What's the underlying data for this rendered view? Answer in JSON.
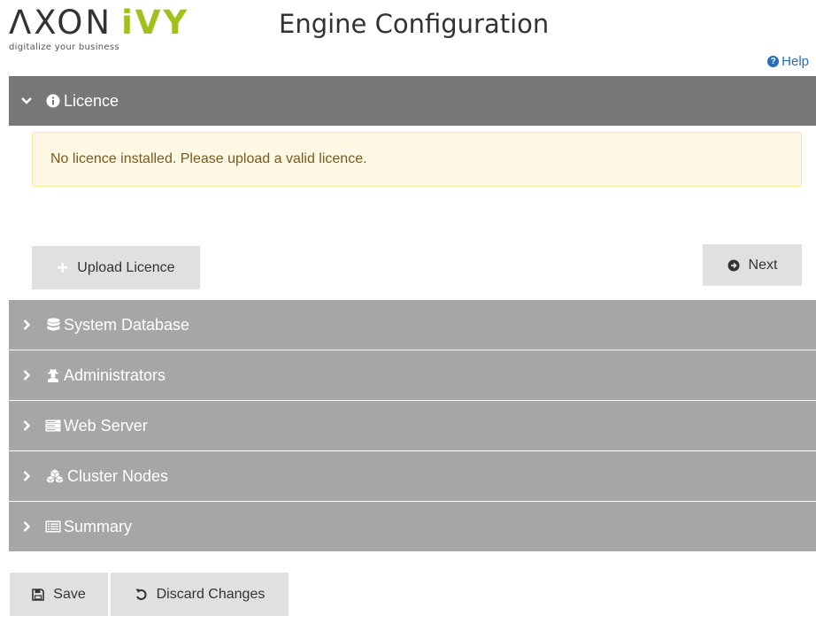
{
  "header": {
    "logo_main": "ΛXON",
    "logo_accent": "iVY",
    "logo_tagline": "digitalize your business",
    "page_title": "Engine Configuration",
    "help_label": "Help"
  },
  "sections": {
    "licence": {
      "label": "Licence",
      "alert_text": "No licence installed. Please upload a valid licence.",
      "upload_label": "Upload Licence",
      "next_label": "Next"
    },
    "system_database": {
      "label": "System Database"
    },
    "administrators": {
      "label": "Administrators"
    },
    "web_server": {
      "label": "Web Server"
    },
    "cluster_nodes": {
      "label": "Cluster Nodes"
    },
    "summary": {
      "label": "Summary"
    }
  },
  "footer": {
    "save_label": "Save",
    "discard_label": "Discard Changes"
  },
  "colors": {
    "active_header": "#777777",
    "collapsed_header": "#a6a6a6",
    "alert_bg": "#fcf8e3",
    "logo_accent": "#9ec21a",
    "link": "#2a6db5"
  },
  "icons": {
    "help": "question-circle-icon",
    "licence": "info-circle-icon",
    "system_database": "database-icon",
    "administrators": "user-secret-icon",
    "web_server": "server-icon",
    "cluster_nodes": "cubes-icon",
    "summary": "list-alt-icon",
    "upload": "plus-icon",
    "next": "arrow-circle-right-icon",
    "save": "floppy-disk-icon",
    "discard": "undo-icon"
  }
}
